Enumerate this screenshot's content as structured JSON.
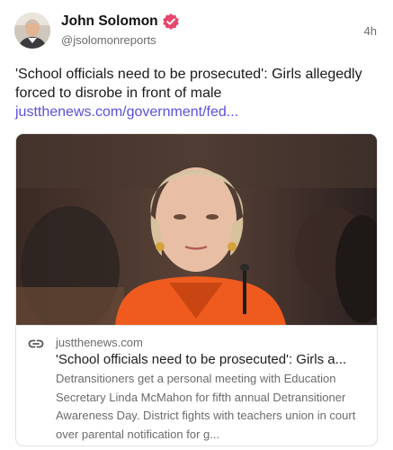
{
  "post": {
    "author": {
      "name": "John Solomon",
      "handle": "@jsolomonreports",
      "avatar_icon": "avatar-photo",
      "verified_icon": "verified-badge-icon",
      "verified_color": "#e8456b"
    },
    "timestamp": "4h",
    "text": "'School officials need to be prosecuted': Girls allegedly forced to disrobe in front of male",
    "link_text": "justthenews.com/government/fed...",
    "link_color": "#5b4fe0"
  },
  "card": {
    "image_icon": "article-photo",
    "link_icon": "link-icon",
    "domain": "justthenews.com",
    "title": "'School officials need to be prosecuted': Girls a...",
    "description": "Detransitioners get a personal meeting with Education Secretary Linda McMahon for fifth annual Detransitioner Awareness Day. District fights with teachers union in court over parental notification for g..."
  }
}
